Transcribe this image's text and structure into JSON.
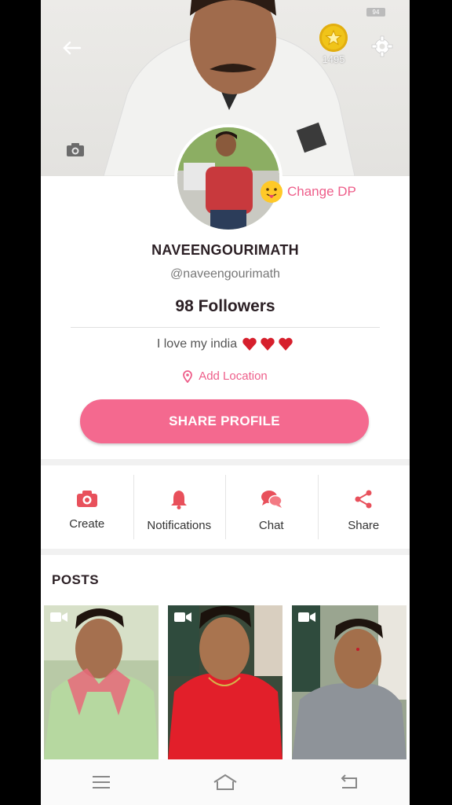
{
  "status": {
    "battery": "94"
  },
  "header": {
    "coin_count": "1495"
  },
  "profile": {
    "change_dp_label": "Change DP",
    "name": "NAVEENGOURIMATH",
    "handle": "@naveengourimath",
    "followers": "98 Followers",
    "bio": "I love my india",
    "location_label": "Add Location",
    "share_button": "SHARE PROFILE"
  },
  "actions": [
    {
      "label": "Create",
      "icon": "camera-icon"
    },
    {
      "label": "Notifications",
      "icon": "bell-icon"
    },
    {
      "label": "Chat",
      "icon": "chat-icon"
    },
    {
      "label": "Share",
      "icon": "share-icon"
    }
  ],
  "posts": {
    "title": "POSTS",
    "count": 3
  },
  "colors": {
    "accent": "#f4698f",
    "accent_text": "#ee5e8a",
    "dark_text": "#2b1f24"
  }
}
